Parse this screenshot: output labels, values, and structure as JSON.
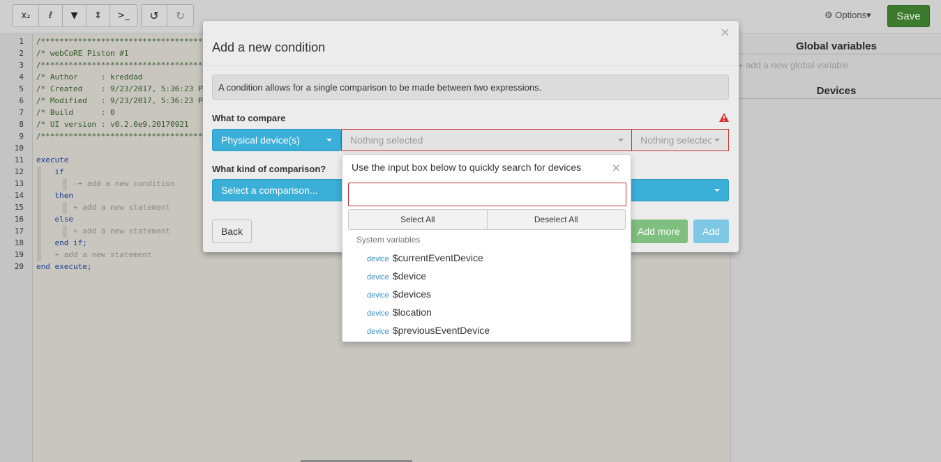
{
  "toolbar": {
    "group1": [
      {
        "name": "subscript-icon",
        "glyph": "x₂"
      },
      {
        "name": "variable-icon",
        "glyph": "ℓ"
      },
      {
        "name": "filter-icon",
        "glyph": "▼"
      },
      {
        "name": "sort-icon",
        "glyph": "⇕"
      },
      {
        "name": "terminal-icon",
        "glyph": ">_"
      }
    ],
    "group2": [
      {
        "name": "undo-icon",
        "glyph": "↺"
      },
      {
        "name": "redo-icon",
        "glyph": "↻"
      }
    ],
    "options_label": "⚙ Options▾",
    "save_label": "Save"
  },
  "code": {
    "line_numbers": [
      "1",
      "2",
      "3",
      "4",
      "5",
      "6",
      "7",
      "8",
      "9",
      "10",
      "11",
      "12",
      "13",
      "14",
      "15",
      "16",
      "17",
      "18",
      "19",
      "20"
    ],
    "lines": [
      {
        "text": "/************************************",
        "cls": "cmt"
      },
      {
        "text": "/* webCoRE Piston #1",
        "cls": "cmt"
      },
      {
        "text": "/************************************",
        "cls": "cmt"
      },
      {
        "text": "/* Author     : kreddad",
        "cls": "cmt"
      },
      {
        "text": "/* Created    : 9/23/2017, 5:36:23 PM",
        "cls": "cmt"
      },
      {
        "text": "/* Modified   : 9/23/2017, 5:36:23 PM",
        "cls": "cmt"
      },
      {
        "text": "/* Build      : 0",
        "cls": "cmt"
      },
      {
        "text": "/* UI version : v0.2.0e9.20170921",
        "cls": "cmt"
      },
      {
        "text": "/************************************",
        "cls": "cmt"
      },
      {
        "text": "",
        "cls": ""
      },
      {
        "text": "execute",
        "cls": "kw"
      },
      {
        "text": "    if",
        "cls": "kw"
      },
      {
        "text": "        -+ add a new condition",
        "cls": "muted"
      },
      {
        "text": "    then",
        "cls": "kw"
      },
      {
        "text": "        + add a new statement",
        "cls": "muted"
      },
      {
        "text": "    else",
        "cls": "kw"
      },
      {
        "text": "        + add a new statement",
        "cls": "muted"
      },
      {
        "text": "    end if;",
        "cls": "kw"
      },
      {
        "text": "    + add a new statement",
        "cls": "muted"
      },
      {
        "text": "end execute;",
        "cls": "kw"
      }
    ]
  },
  "right_panel": {
    "global_title": "Global variables",
    "add_global": "+ add a new global variable",
    "devices_title": "Devices"
  },
  "modal": {
    "title": "Add a new condition",
    "close": "×",
    "info": "A condition allows for a single comparison to be made between two expressions.",
    "what_to_compare": "What to compare",
    "physical_devices": "Physical device(s)",
    "nothing_selected": "Nothing selected",
    "nothing_selected_short": "Nothing selectec",
    "what_kind": "What kind of comparison?",
    "select_comparison": "Select a comparison...",
    "back": "Back",
    "add_more": "Add more",
    "add": "Add"
  },
  "device_popup": {
    "header": "Use the input box below to quickly search for devices",
    "close": "×",
    "search_value": "",
    "select_all": "Select All",
    "deselect_all": "Deselect All",
    "group_label": "System variables",
    "options": [
      {
        "tag": "device",
        "label": "$currentEventDevice"
      },
      {
        "tag": "device",
        "label": "$device"
      },
      {
        "tag": "device",
        "label": "$devices"
      },
      {
        "tag": "device",
        "label": "$location"
      },
      {
        "tag": "device",
        "label": "$previousEventDevice"
      }
    ]
  },
  "colors": {
    "primary": "#3aafd8",
    "save": "#3c7a2e",
    "error_border": "#c9302c",
    "warning": "#e03030"
  }
}
